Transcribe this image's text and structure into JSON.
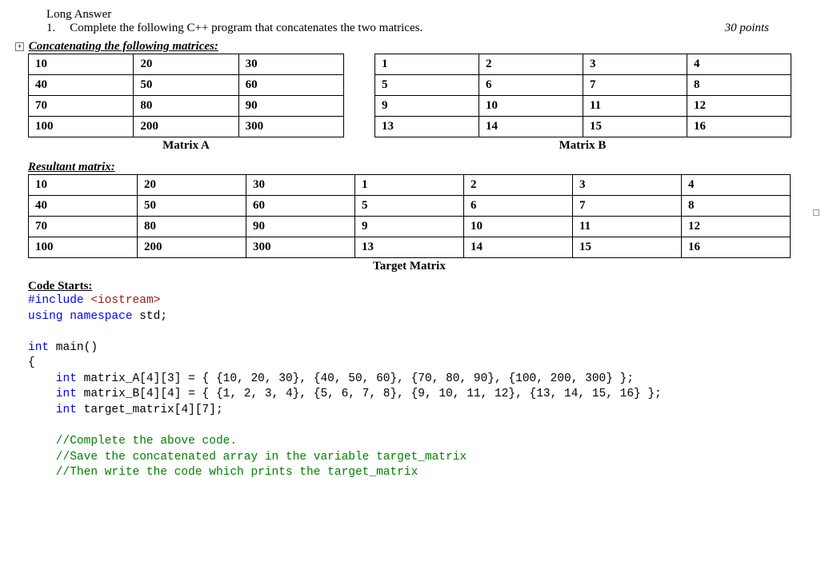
{
  "header": {
    "long_answer": "Long Answer",
    "qnum": "1.",
    "prompt": "Complete the following C++ program that concatenates the two matrices.",
    "points": "30 points"
  },
  "sections": {
    "concat": "Concatenating the following matrices:",
    "resultant": "Resultant matrix:",
    "code_starts": "Code Starts:"
  },
  "captions": {
    "matrixA": "Matrix A",
    "matrixB": "Matrix B",
    "target": "Target Matrix"
  },
  "matrixA": [
    [
      "10",
      "20",
      "30"
    ],
    [
      "40",
      "50",
      "60"
    ],
    [
      "70",
      "80",
      "90"
    ],
    [
      "100",
      "200",
      "300"
    ]
  ],
  "matrixB": [
    [
      "1",
      "2",
      "3",
      "4"
    ],
    [
      "5",
      "6",
      "7",
      "8"
    ],
    [
      "9",
      "10",
      "11",
      "12"
    ],
    [
      "13",
      "14",
      "15",
      "16"
    ]
  ],
  "target": [
    [
      "10",
      "20",
      "30",
      "1",
      "2",
      "3",
      "4"
    ],
    [
      "40",
      "50",
      "60",
      "5",
      "6",
      "7",
      "8"
    ],
    [
      "70",
      "80",
      "90",
      "9",
      "10",
      "11",
      "12"
    ],
    [
      "100",
      "200",
      "300",
      "13",
      "14",
      "15",
      "16"
    ]
  ],
  "code": {
    "l1a": "#include",
    "l1b": " <iostream>",
    "l2a": "using",
    "l2b": " namespace",
    "l2c": " std;",
    "l4a": "int",
    "l4b": " main()",
    "l5": "{",
    "l6a": "    int",
    "l6b": " matrix_A[4][3] = { {10, 20, 30}, {40, 50, 60}, {70, 80, 90}, {100, 200, 300} };",
    "l7a": "    int",
    "l7b": " matrix_B[4][4] = { {1, 2, 3, 4}, {5, 6, 7, 8}, {9, 10, 11, 12}, {13, 14, 15, 16} };",
    "l8a": "    int",
    "l8b": " target_matrix[4][7];",
    "c1": "    //Complete the above code.",
    "c2": "    //Save the concatenated array in the variable target_matrix",
    "c3": "    //Then write the code which prints the target_matrix"
  }
}
